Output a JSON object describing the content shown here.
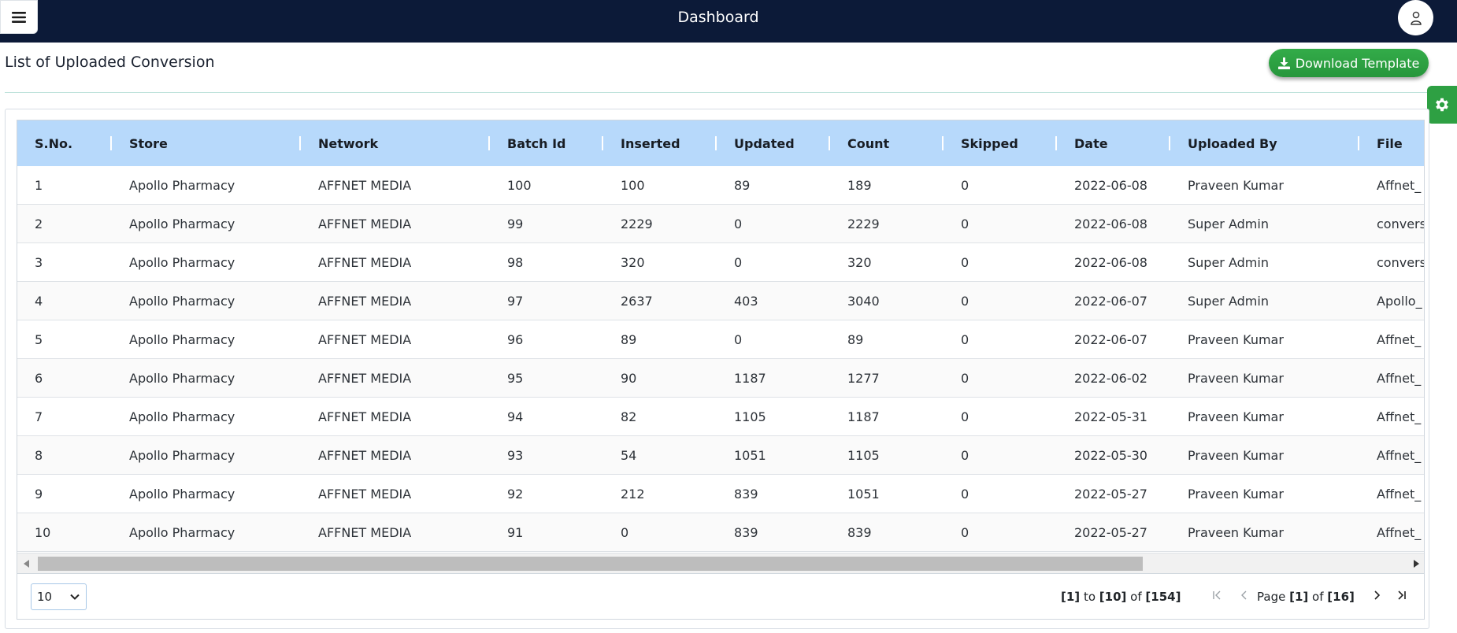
{
  "topbar": {
    "title": "Dashboard",
    "menu_icon": "hamburger-icon",
    "profile_icon": "user-lock-icon"
  },
  "page": {
    "title": "List of Uploaded Conversion",
    "download_label": "Download Template",
    "download_icon": "download-icon",
    "settings_icon": "gear-icon"
  },
  "table": {
    "columns": [
      "S.No.",
      "Store",
      "Network",
      "Batch Id",
      "Inserted",
      "Updated",
      "Count",
      "Skipped",
      "Date",
      "Uploaded By",
      "File"
    ],
    "rows": [
      [
        "1",
        "Apollo Pharmacy",
        "AFFNET MEDIA",
        "100",
        "100",
        "89",
        "189",
        "0",
        "2022-06-08",
        "Praveen Kumar",
        "Affnet_"
      ],
      [
        "2",
        "Apollo Pharmacy",
        "AFFNET MEDIA",
        "99",
        "2229",
        "0",
        "2229",
        "0",
        "2022-06-08",
        "Super Admin",
        "convers"
      ],
      [
        "3",
        "Apollo Pharmacy",
        "AFFNET MEDIA",
        "98",
        "320",
        "0",
        "320",
        "0",
        "2022-06-08",
        "Super Admin",
        "convers"
      ],
      [
        "4",
        "Apollo Pharmacy",
        "AFFNET MEDIA",
        "97",
        "2637",
        "403",
        "3040",
        "0",
        "2022-06-07",
        "Super Admin",
        "Apollo_"
      ],
      [
        "5",
        "Apollo Pharmacy",
        "AFFNET MEDIA",
        "96",
        "89",
        "0",
        "89",
        "0",
        "2022-06-07",
        "Praveen Kumar",
        "Affnet_"
      ],
      [
        "6",
        "Apollo Pharmacy",
        "AFFNET MEDIA",
        "95",
        "90",
        "1187",
        "1277",
        "0",
        "2022-06-02",
        "Praveen Kumar",
        "Affnet_"
      ],
      [
        "7",
        "Apollo Pharmacy",
        "AFFNET MEDIA",
        "94",
        "82",
        "1105",
        "1187",
        "0",
        "2022-05-31",
        "Praveen Kumar",
        "Affnet_"
      ],
      [
        "8",
        "Apollo Pharmacy",
        "AFFNET MEDIA",
        "93",
        "54",
        "1051",
        "1105",
        "0",
        "2022-05-30",
        "Praveen Kumar",
        "Affnet_"
      ],
      [
        "9",
        "Apollo Pharmacy",
        "AFFNET MEDIA",
        "92",
        "212",
        "839",
        "1051",
        "0",
        "2022-05-27",
        "Praveen Kumar",
        "Affnet_"
      ],
      [
        "10",
        "Apollo Pharmacy",
        "AFFNET MEDIA",
        "91",
        "0",
        "839",
        "839",
        "0",
        "2022-05-27",
        "Praveen Kumar",
        "Affnet_"
      ]
    ]
  },
  "pagination": {
    "page_size": "10",
    "from": "[1]",
    "to_word": "to",
    "to": "[10]",
    "of_word": "of",
    "total": "[154]",
    "page_word": "Page",
    "page": "[1]",
    "page_count": "[16]"
  },
  "colors": {
    "topbar": "#0c1a38",
    "header": "#b7d9fb",
    "accent_green": "#2ea043"
  }
}
